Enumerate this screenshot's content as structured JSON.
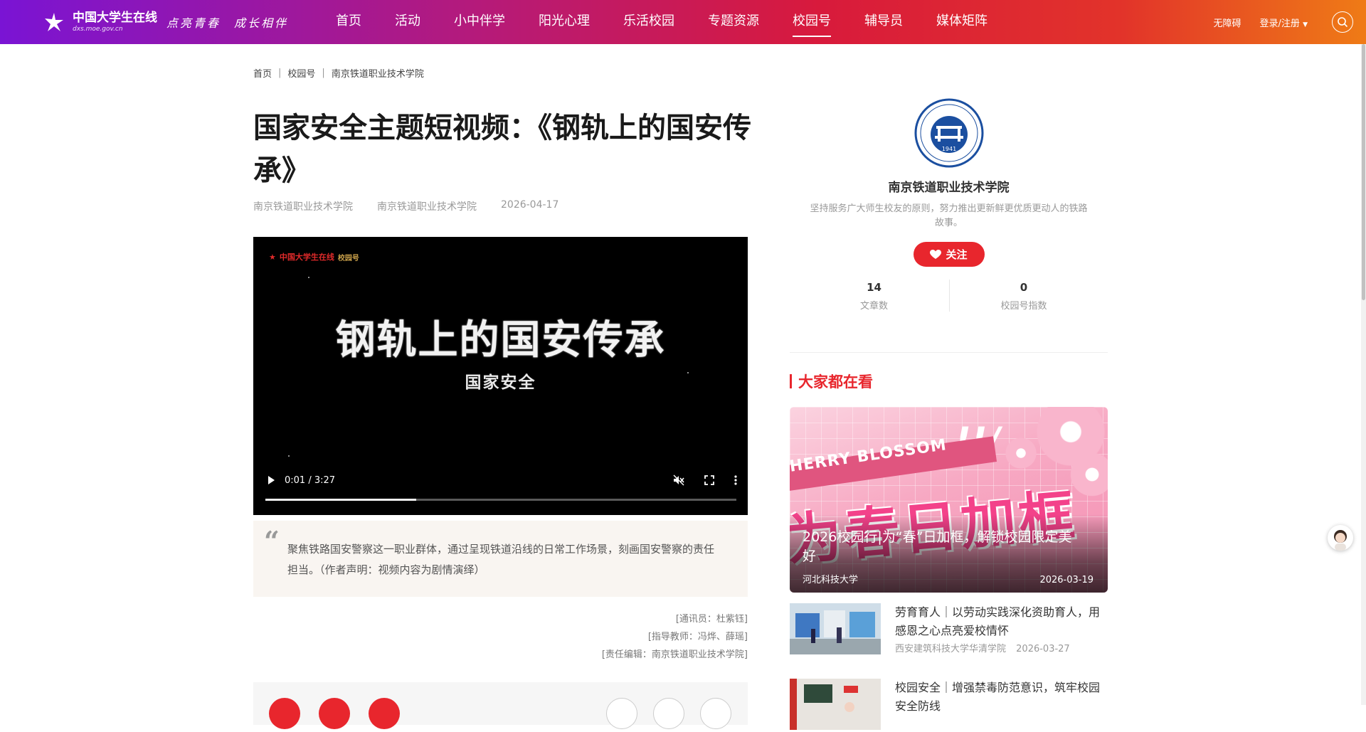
{
  "header": {
    "logo_text": "中国大学生在线",
    "logo_url": "dxs.moe.gov.cn",
    "slogan": "点亮青春　成长相伴",
    "nav": [
      {
        "label": "首页"
      },
      {
        "label": "活动"
      },
      {
        "label": "小中伴学"
      },
      {
        "label": "阳光心理"
      },
      {
        "label": "乐活校园"
      },
      {
        "label": "专题资源"
      },
      {
        "label": "校园号",
        "active": true
      },
      {
        "label": "辅导员"
      },
      {
        "label": "媒体矩阵"
      }
    ],
    "accessibility": "无障碍",
    "login": "登录/注册"
  },
  "breadcrumb": [
    "首页",
    "校园号",
    "南京铁道职业技术学院"
  ],
  "article": {
    "title": "国家安全主题短视频：《钢轨上的国安传承》",
    "author": "南京铁道职业技术学院",
    "source": "南京铁道职业技术学院",
    "date": "2026-04-17",
    "video": {
      "watermark": "中国大学生在线",
      "watermark2": "校园号",
      "title": "钢轨上的国安传承",
      "subtitle": "国家安全",
      "time": "0:01 / 3:27",
      "progress": 0.32
    },
    "summary": "聚焦铁路国安警察这一职业群体，通过呈现铁道沿线的日常工作场景，刻画国安警察的责任担当。（作者声明：视频内容为剧情演绎）",
    "credits": [
      "[通讯员：杜紫钰]",
      "[指导教师：冯烨、薛瑶]",
      "[责任编辑：南京铁道职业技术学院]"
    ]
  },
  "school": {
    "name": "南京铁道职业技术学院",
    "logo_year": "1941",
    "desc": "坚持服务广大师生校友的原则，努力推出更新鲜更优质更动人的铁路故事。",
    "follow_label": "关注",
    "stats": [
      {
        "num": "14",
        "label": "文章数"
      },
      {
        "num": "0",
        "label": "校园号指数"
      }
    ]
  },
  "popular": {
    "title": "大家都在看",
    "hero": {
      "en_text": "HERRY BLOSSOM",
      "big_text": "为春日加框",
      "caption": "2026校园行|为“春”日加框，解锁校园限定美好",
      "source": "河北科技大学",
      "date": "2026-03-19"
    },
    "items": [
      {
        "title": "劳育育人｜以劳动实践深化资助育人，用感恩之心点亮爱校情怀",
        "source": "西安建筑科技大学华清学院",
        "date": "2026-03-27"
      },
      {
        "title": "校园安全｜增强禁毒防范意识，筑牢校园安全防线",
        "source": "",
        "date": ""
      }
    ]
  },
  "colors": {
    "accent": "#e8262d",
    "header_start": "#7a14d4",
    "header_end": "#ef7b16"
  }
}
